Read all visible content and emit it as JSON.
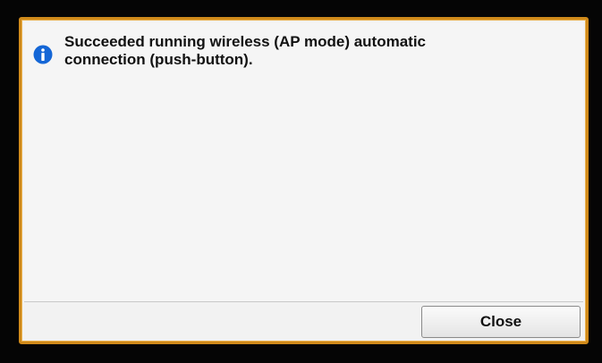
{
  "dialog": {
    "message": "Succeeded running wireless (AP mode) automatic\nconnection (push-button).",
    "icon": "info-icon",
    "close_label": "Close"
  },
  "colors": {
    "frame_border": "#d08a1a",
    "info_icon": "#1466d6",
    "background": "#f5f5f5"
  }
}
